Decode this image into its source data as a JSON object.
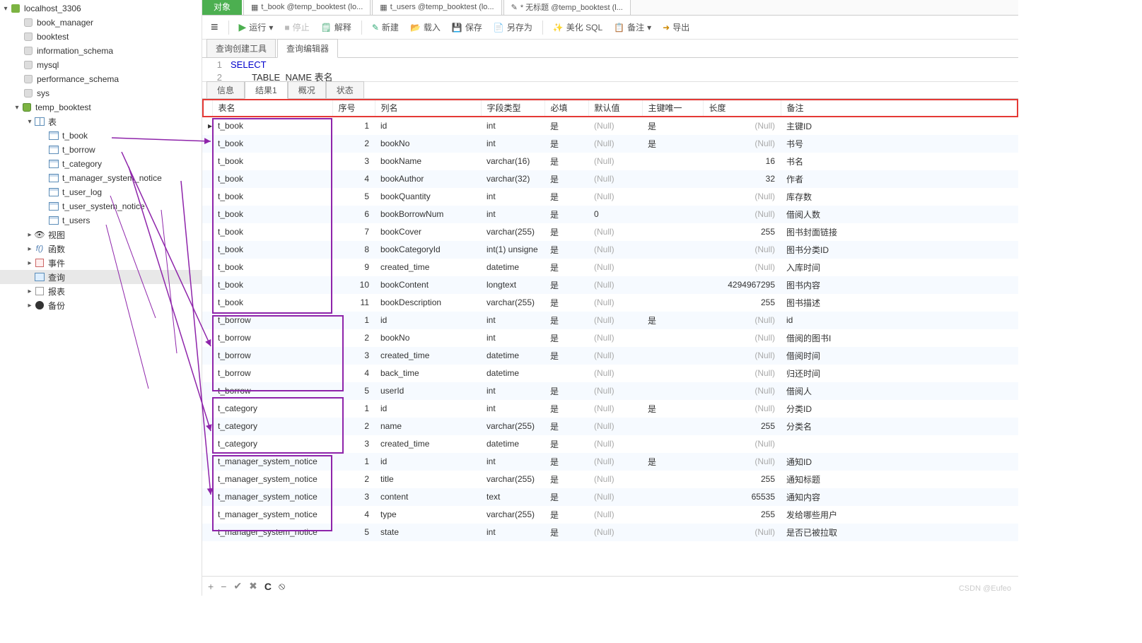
{
  "connection": "localhost_3306",
  "databases": [
    "book_manager",
    "booktest",
    "information_schema",
    "mysql",
    "performance_schema",
    "sys"
  ],
  "active_db": "temp_booktest",
  "db_tree": {
    "tables_label": "表",
    "tables": [
      "t_book",
      "t_borrow",
      "t_category",
      "t_manager_system_notice",
      "t_user_log",
      "t_user_system_notice",
      "t_users"
    ],
    "views": "视图",
    "functions": "函数",
    "events": "事件",
    "queries": "查询",
    "reports": "报表",
    "backups": "备份"
  },
  "top_tabs": {
    "objects": "对象",
    "files": [
      {
        "label": "t_book @temp_booktest (lo...",
        "kind": "table"
      },
      {
        "label": "t_users @temp_booktest (lo...",
        "kind": "table"
      },
      {
        "label": "* 无标题 @temp_booktest (l...",
        "kind": "query",
        "active": true
      }
    ]
  },
  "toolbar": {
    "run": "运行",
    "stop": "停止",
    "explain": "解释",
    "new": "新建",
    "load": "载入",
    "save": "保存",
    "saveas": "另存为",
    "beautify": "美化 SQL",
    "remarks": "备注",
    "export": "导出"
  },
  "sub_tabs": {
    "builder": "查询创建工具",
    "editor": "查询编辑器"
  },
  "code": {
    "line1": "SELECT",
    "line2": "TABLE_NAME 表名"
  },
  "res_tabs": {
    "info": "信息",
    "result1": "结果1",
    "profile": "概况",
    "status": "状态"
  },
  "columns": {
    "tname": "表名",
    "seq": "序号",
    "cname": "列名",
    "dtype": "字段类型",
    "req": "必填",
    "def": "默认值",
    "pk": "主键唯一",
    "len": "长度",
    "rem": "备注"
  },
  "rows": [
    {
      "t": "t_book",
      "s": 1,
      "c": "id",
      "d": "int",
      "r": "是",
      "def": "(Null)",
      "pk": "是",
      "len": "(Null)",
      "rem": "主键ID"
    },
    {
      "t": "t_book",
      "s": 2,
      "c": "bookNo",
      "d": "int",
      "r": "是",
      "def": "(Null)",
      "pk": "是",
      "len": "(Null)",
      "rem": "书号"
    },
    {
      "t": "t_book",
      "s": 3,
      "c": "bookName",
      "d": "varchar(16)",
      "r": "是",
      "def": "(Null)",
      "pk": "",
      "len": "16",
      "rem": "书名"
    },
    {
      "t": "t_book",
      "s": 4,
      "c": "bookAuthor",
      "d": "varchar(32)",
      "r": "是",
      "def": "(Null)",
      "pk": "",
      "len": "32",
      "rem": "作者"
    },
    {
      "t": "t_book",
      "s": 5,
      "c": "bookQuantity",
      "d": "int",
      "r": "是",
      "def": "(Null)",
      "pk": "",
      "len": "(Null)",
      "rem": "库存数"
    },
    {
      "t": "t_book",
      "s": 6,
      "c": "bookBorrowNum",
      "d": "int",
      "r": "是",
      "def": "0",
      "pk": "",
      "len": "(Null)",
      "rem": "借阅人数"
    },
    {
      "t": "t_book",
      "s": 7,
      "c": "bookCover",
      "d": "varchar(255)",
      "r": "是",
      "def": "(Null)",
      "pk": "",
      "len": "255",
      "rem": "图书封面链接"
    },
    {
      "t": "t_book",
      "s": 8,
      "c": "bookCategoryId",
      "d": "int(1) unsigne",
      "r": "是",
      "def": "(Null)",
      "pk": "",
      "len": "(Null)",
      "rem": "图书分类ID"
    },
    {
      "t": "t_book",
      "s": 9,
      "c": "created_time",
      "d": "datetime",
      "r": "是",
      "def": "(Null)",
      "pk": "",
      "len": "(Null)",
      "rem": "入库时间"
    },
    {
      "t": "t_book",
      "s": 10,
      "c": "bookContent",
      "d": "longtext",
      "r": "是",
      "def": "(Null)",
      "pk": "",
      "len": "4294967295",
      "rem": "图书内容"
    },
    {
      "t": "t_book",
      "s": 11,
      "c": "bookDescription",
      "d": "varchar(255)",
      "r": "是",
      "def": "(Null)",
      "pk": "",
      "len": "255",
      "rem": "图书描述"
    },
    {
      "t": "t_borrow",
      "s": 1,
      "c": "id",
      "d": "int",
      "r": "是",
      "def": "(Null)",
      "pk": "是",
      "len": "(Null)",
      "rem": "id"
    },
    {
      "t": "t_borrow",
      "s": 2,
      "c": "bookNo",
      "d": "int",
      "r": "是",
      "def": "(Null)",
      "pk": "",
      "len": "(Null)",
      "rem": "借阅的图书I"
    },
    {
      "t": "t_borrow",
      "s": 3,
      "c": "created_time",
      "d": "datetime",
      "r": "是",
      "def": "(Null)",
      "pk": "",
      "len": "(Null)",
      "rem": "借阅时间"
    },
    {
      "t": "t_borrow",
      "s": 4,
      "c": "back_time",
      "d": "datetime",
      "r": "",
      "def": "(Null)",
      "pk": "",
      "len": "(Null)",
      "rem": "归还时间"
    },
    {
      "t": "t_borrow",
      "s": 5,
      "c": "userId",
      "d": "int",
      "r": "是",
      "def": "(Null)",
      "pk": "",
      "len": "(Null)",
      "rem": "借阅人"
    },
    {
      "t": "t_category",
      "s": 1,
      "c": "id",
      "d": "int",
      "r": "是",
      "def": "(Null)",
      "pk": "是",
      "len": "(Null)",
      "rem": "分类ID"
    },
    {
      "t": "t_category",
      "s": 2,
      "c": "name",
      "d": "varchar(255)",
      "r": "是",
      "def": "(Null)",
      "pk": "",
      "len": "255",
      "rem": "分类名"
    },
    {
      "t": "t_category",
      "s": 3,
      "c": "created_time",
      "d": "datetime",
      "r": "是",
      "def": "(Null)",
      "pk": "",
      "len": "(Null)",
      "rem": ""
    },
    {
      "t": "t_manager_system_notice",
      "s": 1,
      "c": "id",
      "d": "int",
      "r": "是",
      "def": "(Null)",
      "pk": "是",
      "len": "(Null)",
      "rem": "通知ID"
    },
    {
      "t": "t_manager_system_notice",
      "s": 2,
      "c": "title",
      "d": "varchar(255)",
      "r": "是",
      "def": "(Null)",
      "pk": "",
      "len": "255",
      "rem": "通知标题"
    },
    {
      "t": "t_manager_system_notice",
      "s": 3,
      "c": "content",
      "d": "text",
      "r": "是",
      "def": "(Null)",
      "pk": "",
      "len": "65535",
      "rem": "通知内容"
    },
    {
      "t": "t_manager_system_notice",
      "s": 4,
      "c": "type",
      "d": "varchar(255)",
      "r": "是",
      "def": "(Null)",
      "pk": "",
      "len": "255",
      "rem": "发给哪些用户"
    },
    {
      "t": "t_manager_system_notice",
      "s": 5,
      "c": "state",
      "d": "int",
      "r": "是",
      "def": "(Null)",
      "pk": "",
      "len": "(Null)",
      "rem": "是否已被拉取"
    }
  ],
  "watermark": "CSDN @Eufeo"
}
